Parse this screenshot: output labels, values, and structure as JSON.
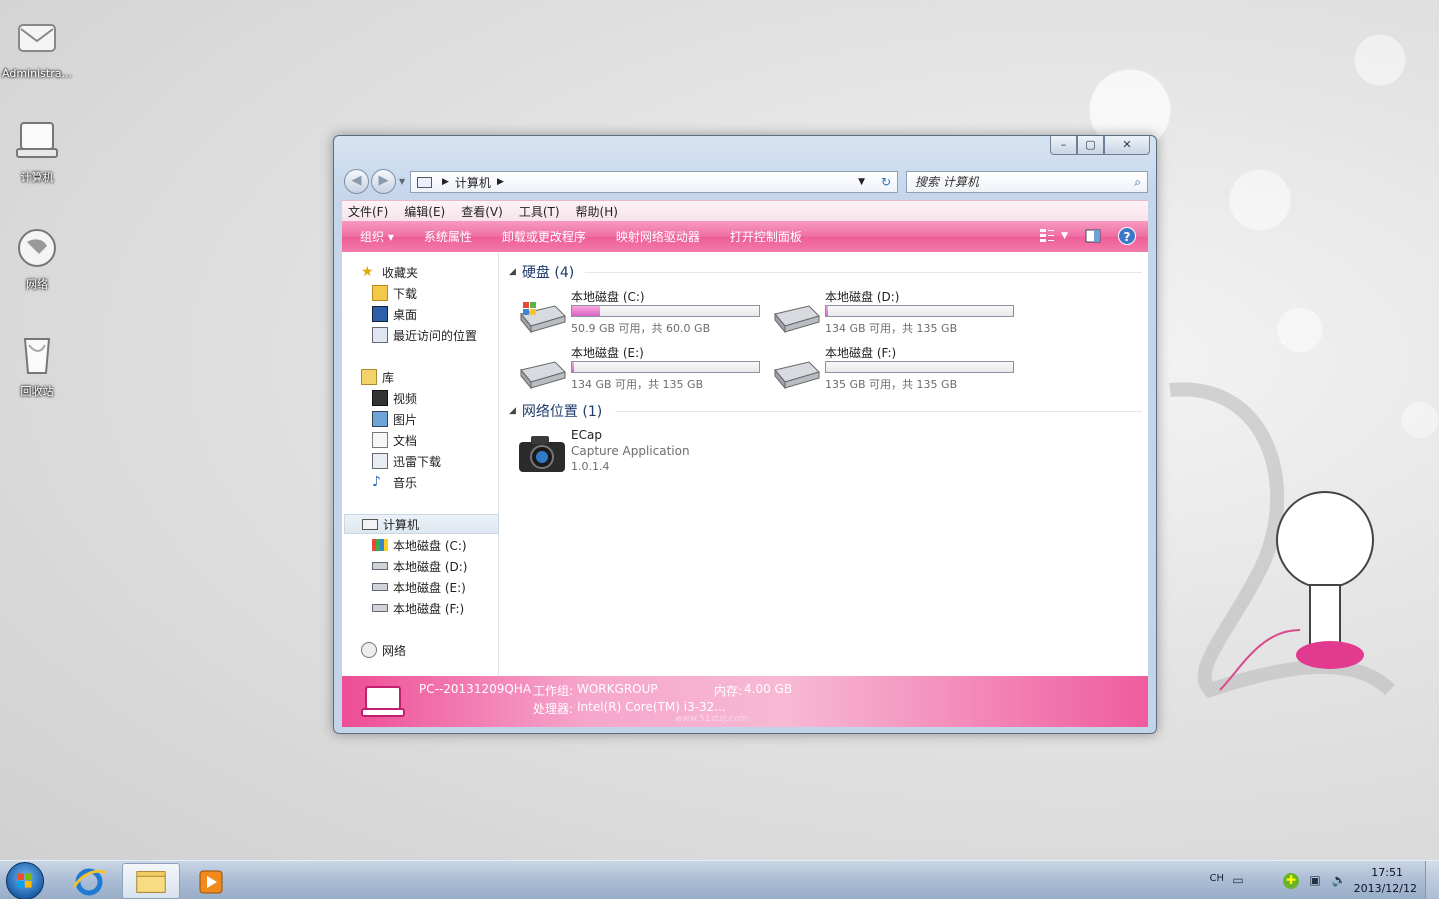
{
  "desktop": {
    "icons": [
      {
        "label": "Administra...",
        "icon": "user-folder-icon"
      },
      {
        "label": "计算机",
        "icon": "computer-icon"
      },
      {
        "label": "网络",
        "icon": "network-icon"
      },
      {
        "label": "回收站",
        "icon": "recycle-bin-icon"
      }
    ]
  },
  "window": {
    "caption": {
      "minimize": "–",
      "maximize": "▢",
      "close": "✕"
    },
    "address": {
      "crumb": "计算机"
    },
    "search": {
      "placeholder": "搜索 计算机"
    },
    "menu": [
      "文件(F)",
      "编辑(E)",
      "查看(V)",
      "工具(T)",
      "帮助(H)"
    ],
    "toolbar": {
      "organize": "组织 ▾",
      "items": [
        "系统属性",
        "卸载或更改程序",
        "映射网络驱动器",
        "打开控制面板"
      ],
      "help": "?"
    },
    "nav": {
      "favorites": "收藏夹",
      "fav_items": [
        "下载",
        "桌面",
        "最近访问的位置"
      ],
      "libraries": "库",
      "lib_items": [
        "视频",
        "图片",
        "文档",
        "迅雷下载",
        "音乐"
      ],
      "computer": "计算机",
      "drives": [
        "本地磁盘 (C:)",
        "本地磁盘 (D:)",
        "本地磁盘 (E:)",
        "本地磁盘 (F:)"
      ],
      "network": "网络"
    },
    "content": {
      "hdd_header": "硬盘 (4)",
      "drives": [
        {
          "name": "本地磁盘 (C:)",
          "free": "50.9 GB 可用，共 60.0 GB",
          "used_fraction": 0.15
        },
        {
          "name": "本地磁盘 (D:)",
          "free": "134 GB 可用，共 135 GB",
          "used_fraction": 0.01
        },
        {
          "name": "本地磁盘 (E:)",
          "free": "134 GB 可用，共 135 GB",
          "used_fraction": 0.01
        },
        {
          "name": "本地磁盘 (F:)",
          "free": "135 GB 可用，共 135 GB",
          "used_fraction": 0.0
        }
      ],
      "net_header": "网络位置 (1)",
      "net_item": {
        "name": "ECap",
        "desc": "Capture Application",
        "version": "1.0.1.4"
      }
    },
    "details": {
      "pc_name": "PC--20131209QHA",
      "workgroup_label": "工作组:",
      "workgroup": "WORKGROUP",
      "memory_label": "内存:",
      "memory": "4.00 GB",
      "cpu_label": "处理器:",
      "cpu": "Intel(R) Core(TM) i3-32...",
      "watermark": "www.51ztzj.com"
    }
  },
  "taskbar": {
    "lang": "CH",
    "time": "17:51",
    "date": "2013/12/12"
  },
  "colors": {
    "accent": "#ee5d97",
    "window_frame": "#c5d6eb"
  }
}
